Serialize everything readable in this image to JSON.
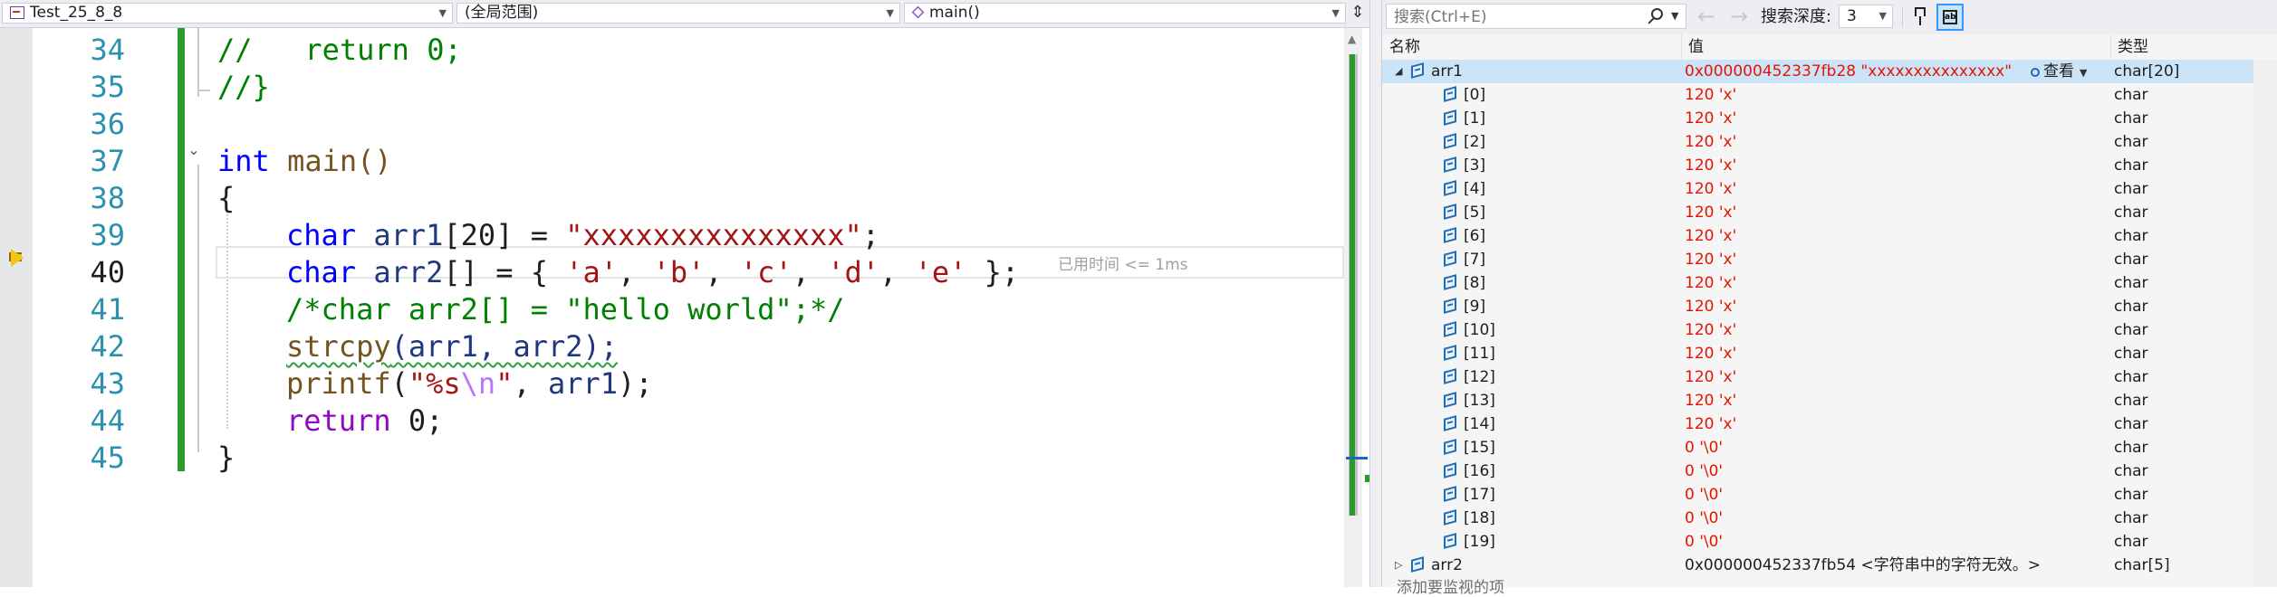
{
  "editor": {
    "nav": {
      "project": "Test_25_8_8",
      "scope": "(全局范围)",
      "function": "main()"
    },
    "current_line": 40,
    "line_numbers": [
      "34",
      "35",
      "36",
      "37",
      "38",
      "39",
      "40",
      "41",
      "42",
      "43",
      "44",
      "45"
    ],
    "elapsed": "已用时间 <= 1ms",
    "lines": {
      "l34a": "//",
      "l34b": "   return 0;",
      "l35": "//}",
      "l37kw": "int",
      "l37rest": " main()",
      "l38": "{",
      "l39kw": "char",
      "l39var": " arr1",
      "l39mid": "[20] = ",
      "l39str": "\"xxxxxxxxxxxxxxx\"",
      "l39end": ";",
      "l40kw": "char",
      "l40var": " arr2",
      "l40mid": "[] = { ",
      "l40c1": "'a'",
      "l40c2": "'b'",
      "l40c3": "'c'",
      "l40c4": "'d'",
      "l40c5": "'e'",
      "l40sep": ", ",
      "l40end": " };",
      "l41": "/*char arr2[] = \"hello world\";*/",
      "l42fn": "strcpy",
      "l42rest": "(arr1, arr2);",
      "l43fn": "printf",
      "l43open": "(",
      "l43str1": "\"%s",
      "l43esc": "\\n",
      "l43str2": "\"",
      "l43comma": ", ",
      "l43var": "arr1",
      "l43end": ");",
      "l44kw": "return",
      "l44rest": " 0;",
      "l45": "}"
    }
  },
  "watch": {
    "search_placeholder": "搜索(Ctrl+E)",
    "depth_label": "搜索深度:",
    "depth_value": "3",
    "columns": {
      "name": "名称",
      "value": "值",
      "type": "类型"
    },
    "viewer_label": "查看",
    "arr1": {
      "name": "arr1",
      "value": "0x000000452337fb28 \"xxxxxxxxxxxxxxx\"",
      "type": "char[20]"
    },
    "elements": [
      {
        "name": "[0]",
        "value": "120 'x'",
        "type": "char"
      },
      {
        "name": "[1]",
        "value": "120 'x'",
        "type": "char"
      },
      {
        "name": "[2]",
        "value": "120 'x'",
        "type": "char"
      },
      {
        "name": "[3]",
        "value": "120 'x'",
        "type": "char"
      },
      {
        "name": "[4]",
        "value": "120 'x'",
        "type": "char"
      },
      {
        "name": "[5]",
        "value": "120 'x'",
        "type": "char"
      },
      {
        "name": "[6]",
        "value": "120 'x'",
        "type": "char"
      },
      {
        "name": "[7]",
        "value": "120 'x'",
        "type": "char"
      },
      {
        "name": "[8]",
        "value": "120 'x'",
        "type": "char"
      },
      {
        "name": "[9]",
        "value": "120 'x'",
        "type": "char"
      },
      {
        "name": "[10]",
        "value": "120 'x'",
        "type": "char"
      },
      {
        "name": "[11]",
        "value": "120 'x'",
        "type": "char"
      },
      {
        "name": "[12]",
        "value": "120 'x'",
        "type": "char"
      },
      {
        "name": "[13]",
        "value": "120 'x'",
        "type": "char"
      },
      {
        "name": "[14]",
        "value": "120 'x'",
        "type": "char"
      },
      {
        "name": "[15]",
        "value": "0 '\\0'",
        "type": "char"
      },
      {
        "name": "[16]",
        "value": "0 '\\0'",
        "type": "char"
      },
      {
        "name": "[17]",
        "value": "0 '\\0'",
        "type": "char"
      },
      {
        "name": "[18]",
        "value": "0 '\\0'",
        "type": "char"
      },
      {
        "name": "[19]",
        "value": "0 '\\0'",
        "type": "char"
      }
    ],
    "arr2": {
      "name": "arr2",
      "value": "0x000000452337fb54 <字符串中的字符无效。>",
      "type": "char[5]"
    },
    "add_item": "添加要监视的项"
  },
  "colors": {
    "changed_value": "#e51400",
    "keyword": "#0000ff",
    "string": "#a31515",
    "comment": "#008000",
    "line_number": "#2b91af",
    "change_bar": "#2a9a2a",
    "selection": "#cce4f7"
  },
  "icons": [
    "project-icon",
    "cube-icon",
    "split-icon",
    "execution-pointer-icon",
    "search-icon",
    "back-arrow-icon",
    "forward-arrow-icon",
    "pin-icon",
    "hex-display-icon",
    "variable-icon",
    "magnifier-icon"
  ]
}
